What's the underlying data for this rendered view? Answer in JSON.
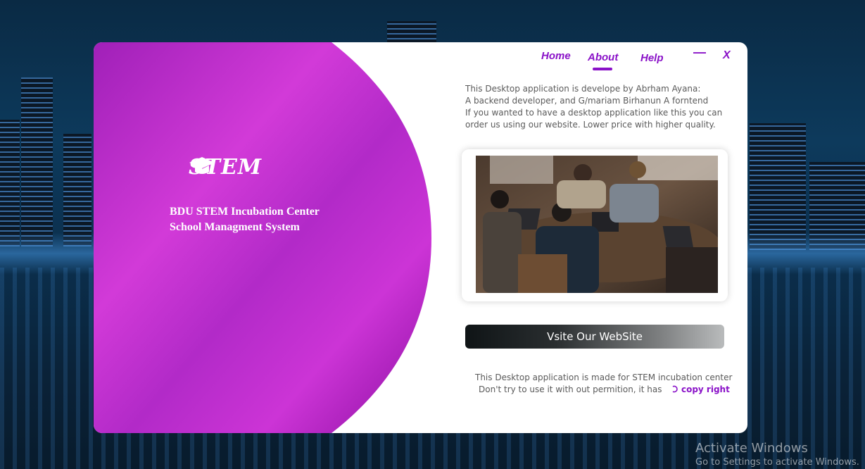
{
  "nav": {
    "home": "Home",
    "about": "About",
    "help": "Help",
    "minimize": "—",
    "close": "X"
  },
  "brand": {
    "logo_text": "STEM",
    "org_line1": "BDU STEM Incubation Center",
    "org_line2": "School Managment System"
  },
  "about": {
    "lines": [
      "This Desktop application is develope by Abrham Ayana:",
      "A backend developer, and G/mariam Birhanun A forntend",
      "If you wanted to have a desktop application like this you can",
      "order us using our website. Lower price with higher quality."
    ],
    "website_button": "Vsite Our WebSite",
    "footer_line1": "This Desktop application is made for STEM incubation center",
    "footer_line2": "Don't try to use  it with out permition, it has",
    "copyright": "copy right"
  },
  "watermark": {
    "title": "Activate Windows",
    "subtitle": "Go to Settings to activate Windows."
  },
  "colors": {
    "accent": "#8a12c8",
    "panel_purple": "#c830d0"
  }
}
